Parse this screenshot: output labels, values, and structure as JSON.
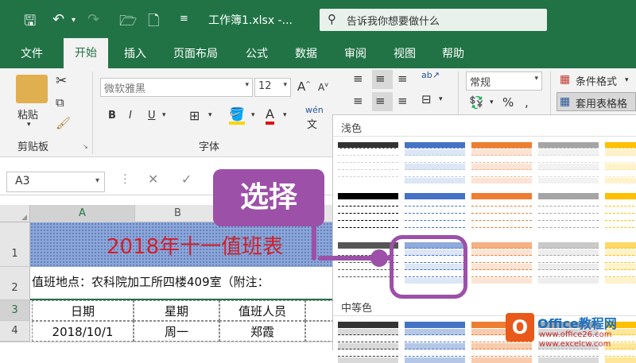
{
  "titlebar": {
    "file_name": "工作簿1.xlsx  -...",
    "tell_me": "告诉我你想要做什么"
  },
  "tabs": [
    "文件",
    "开始",
    "插入",
    "页面布局",
    "公式",
    "数据",
    "审阅",
    "视图",
    "帮助"
  ],
  "ribbon": {
    "clipboard": {
      "paste": "粘贴",
      "label": "剪贴板"
    },
    "font": {
      "name": "微软雅黑",
      "size": "12",
      "label": "字体",
      "bold": "B",
      "italic": "I",
      "underline": "U",
      "wen": "wén"
    },
    "number": {
      "format": "常规",
      "percent": "%"
    },
    "styles": {
      "cond_format": "条件格式",
      "table_format": "套用表格格"
    }
  },
  "formula_bar": {
    "name_box": "A3"
  },
  "sheet": {
    "columns": [
      "A",
      "B"
    ],
    "rows": [
      "1",
      "2",
      "3",
      "4"
    ],
    "title": "2018年十一值班表",
    "row2": "值班地点：农科院加工所四楼409室（附注：",
    "header": [
      "日期",
      "星期",
      "值班人员"
    ],
    "row4": [
      "2018/10/1",
      "周一",
      "郑霞"
    ]
  },
  "gallery": {
    "light_label": "浅色",
    "medium_label": "中等色"
  },
  "callout": "选择",
  "watermark": {
    "line1": "Office教程网",
    "line2": "www.office26.com",
    "line3": "www.excelcw.com"
  },
  "colors": {
    "excel_green": "#217346",
    "callout_purple": "#9c50a8",
    "title_red": "#d1202d"
  }
}
